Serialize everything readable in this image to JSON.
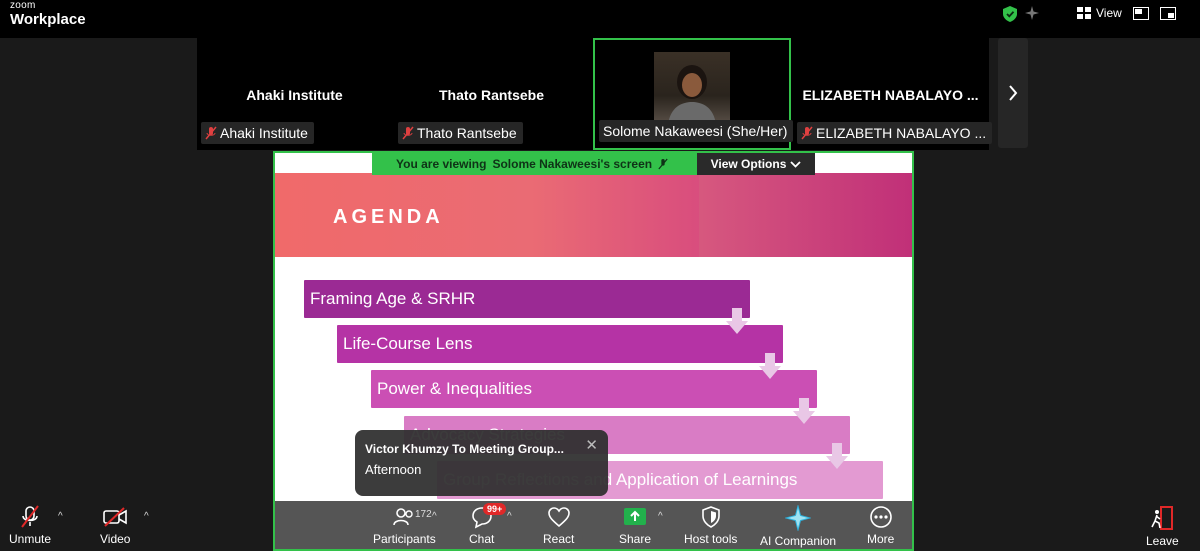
{
  "app": {
    "brand_top": "zoom",
    "brand_bottom": "Workplace"
  },
  "topbar": {
    "view_label": "View"
  },
  "gallery": [
    {
      "big_name": "Ahaki Institute",
      "tag": "Ahaki Institute",
      "muted": true
    },
    {
      "big_name": "Thato Rantsebe",
      "tag": "Thato Rantsebe",
      "muted": true
    },
    {
      "big_name": "",
      "tag": "Solome Nakaweesi (She/Her)",
      "muted": false,
      "active": true
    },
    {
      "big_name": "ELIZABETH NABALAYO ...",
      "tag": "ELIZABETH NABALAYO ...",
      "muted": true
    }
  ],
  "share_bar": {
    "viewing_prefix": "You are viewing",
    "viewing_name": "Solome Nakaweesi's screen",
    "view_options": "View Options"
  },
  "slide": {
    "heading": "AGENDA",
    "items": [
      "Framing Age & SRHR",
      "Life-Course Lens",
      "Power & Inequalities",
      "Advocacy Strategies",
      "Group Reflections and Application of Learnings"
    ],
    "colors": [
      "#9b2a94",
      "#b533a5",
      "#cb4fb4",
      "#d97cc5",
      "#e39ad2"
    ]
  },
  "toast": {
    "title": "Victor Khumzy To Meeting Group...",
    "message": "Afternoon"
  },
  "toolbar": {
    "unmute": "Unmute",
    "video": "Video",
    "participants": "Participants",
    "participants_count": "172",
    "chat": "Chat",
    "chat_badge": "99+",
    "react": "React",
    "share": "Share",
    "host_tools": "Host tools",
    "ai_companion": "AI Companion",
    "more": "More",
    "leave": "Leave"
  },
  "colors": {
    "accent_green": "#33c14a",
    "share_green": "#22b14c",
    "leave_red": "#e02828"
  }
}
